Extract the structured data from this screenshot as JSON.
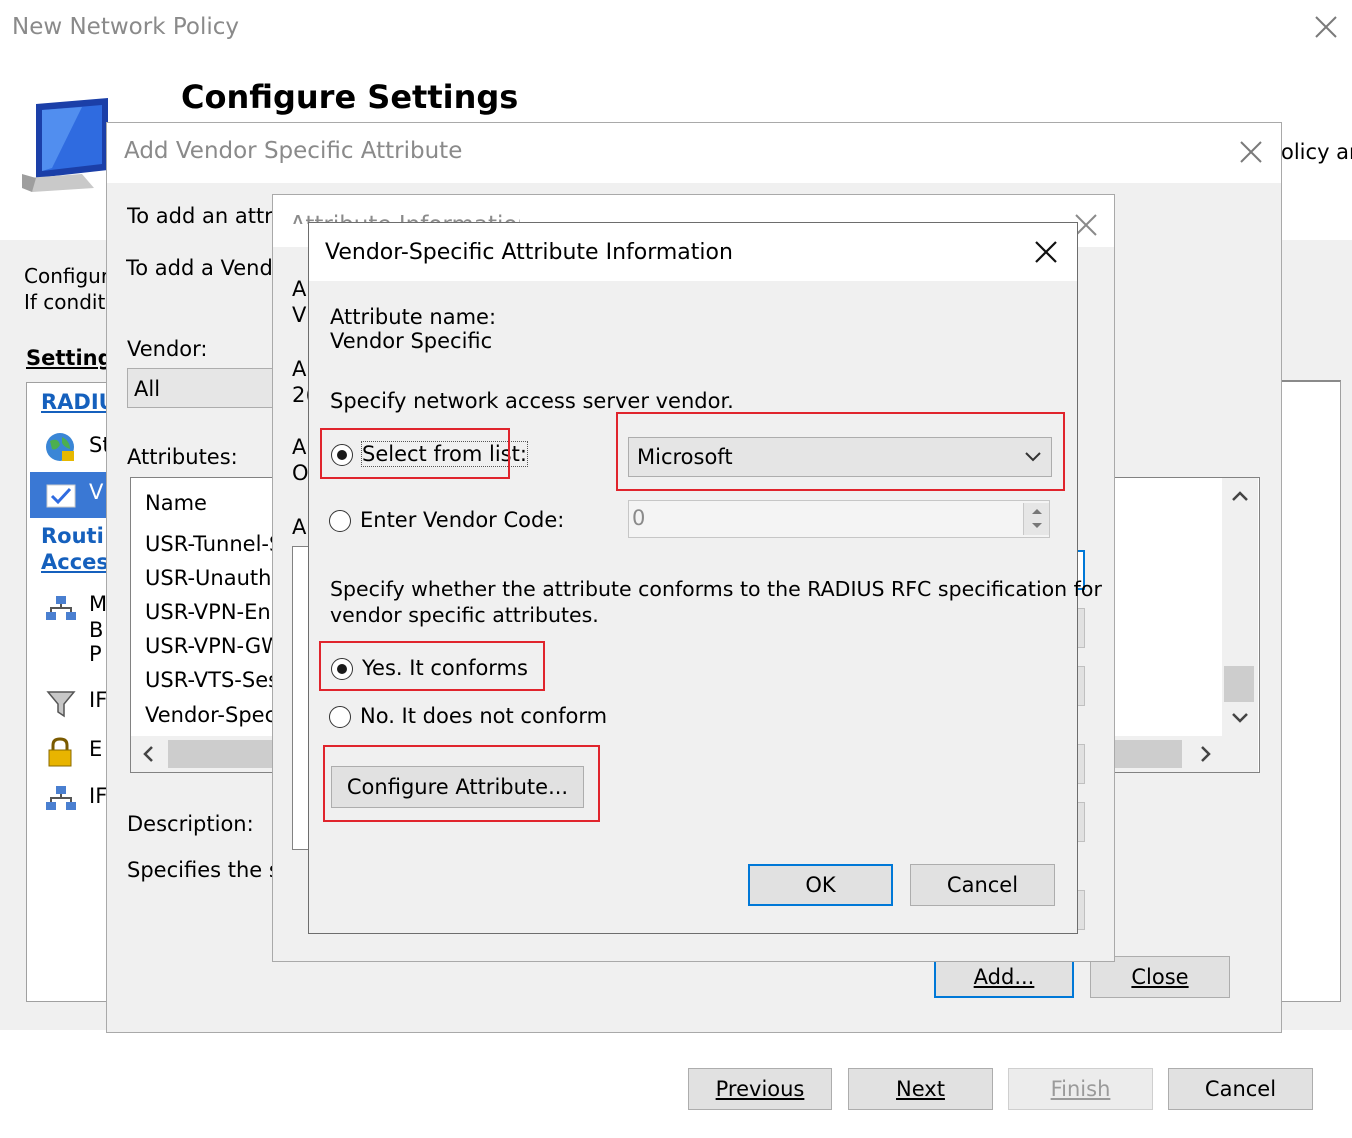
{
  "wizard": {
    "title": "New Network Policy",
    "heading": "Configure Settings",
    "header_right_fragment": "olicy are",
    "intro_line1_fragment": "Configure",
    "intro_line2_fragment": "If conditi",
    "settings_label_fragment": "Settings",
    "nav": {
      "radius_header_fragment": "RADIU",
      "item_s_fragment": "St",
      "item_v_fragment": "V",
      "routing_fragment_1": "Routi",
      "routing_fragment_2": "Acces",
      "item_m_1": "M",
      "item_m_2": "B",
      "item_m_3": "P",
      "item_ip_filter_fragment": "IF",
      "item_encryption_fragment": "E",
      "item_ip_settings_fragment": "IF"
    },
    "buttons": {
      "previous": "Previous",
      "next": "Next",
      "finish": "Finish",
      "cancel": "Cancel"
    }
  },
  "add_vsa": {
    "title": "Add Vendor Specific Attribute",
    "intro1_fragment": "To add an attrib",
    "intro2_fragment": "To add a Vendo",
    "vendor_label": "Vendor:",
    "vendor_value": "All",
    "attributes_label": "Attributes:",
    "list_header": "Name",
    "list_items": [
      "USR-Tunnel-S",
      "USR-Unauthe",
      "USR-VPN-En",
      "USR-VPN-GW",
      "USR-VTS-Ses",
      "Vendor-Speci"
    ],
    "description_label": "Description:",
    "description_fragment": "Specifies the su",
    "add_button": "Add...",
    "close_button": "Close"
  },
  "attr_info": {
    "title_fragment": "Attribute Information",
    "frag_a1": "A",
    "frag_v": "V",
    "frag_a2": "A",
    "frag_2": "2(",
    "frag_a3": "A",
    "frag_o": "O",
    "frag_a4": "A"
  },
  "vsa_dialog": {
    "title": "Vendor-Specific Attribute Information",
    "attribute_name_label": "Attribute name:",
    "attribute_name_value": "Vendor Specific",
    "specify_vendor_text": "Specify network access server vendor.",
    "select_from_list_label": "Select from list:",
    "select_from_list_checked": true,
    "vendor_selected": "Microsoft",
    "enter_vendor_code_label": "Enter Vendor Code:",
    "enter_vendor_code_checked": false,
    "vendor_code_value": "0",
    "conform_text_line1": "Specify whether the attribute conforms to the RADIUS RFC specification for",
    "conform_text_line2": "vendor specific attributes.",
    "yes_label": "Yes. It conforms",
    "yes_checked": true,
    "no_label": "No. It does not conform",
    "no_checked": false,
    "configure_button": "Configure Attribute...",
    "ok_button": "OK",
    "cancel_button": "Cancel"
  },
  "colors": {
    "highlight_box": "#e0242c",
    "focus_blue": "#0078d7",
    "nav_header_blue": "#1560bd",
    "dialog_bg": "#f0f0f0"
  }
}
